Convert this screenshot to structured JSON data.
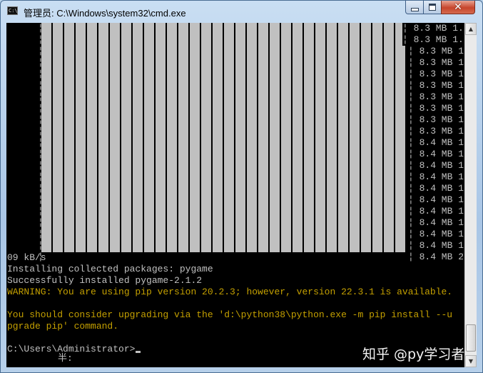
{
  "window": {
    "title": "管理员: C:\\Windows\\system32\\cmd.exe",
    "icon": "cmd-icon",
    "controls": [
      "minimize-icon",
      "maximize-icon",
      "close-icon"
    ]
  },
  "progress_rows": [
    "¦ 8.3 MB 1.",
    "¦ 8.3 MB 1.",
    "¦ 8.3 MB 1",
    "¦ 8.3 MB 1",
    "¦ 8.3 MB 1",
    "¦ 8.3 MB 1",
    "¦ 8.3 MB 1",
    "¦ 8.3 MB 1",
    "¦ 8.3 MB 1",
    "¦ 8.3 MB 1",
    "¦ 8.4 MB 1",
    "¦ 8.4 MB 1",
    "¦ 8.4 MB 1",
    "¦ 8.4 MB 1",
    "¦ 8.4 MB 1",
    "¦ 8.4 MB 1",
    "¦ 8.4 MB 1",
    "¦ 8.4 MB 1",
    "¦ 8.4 MB 1",
    "¦ 8.4 MB 1",
    "¦ 8.4 MB 2"
  ],
  "console": {
    "speed_tail": "09 kB/s",
    "installing": "Installing collected packages: pygame",
    "success": "Successfully installed pygame-2.1.2",
    "warning1": "WARNING: You are using pip version 20.2.3; however, version 22.3.1 is available.",
    "warning2a": "You should consider upgrading via the 'd:\\python38\\python.exe -m pip install --u",
    "warning2b": "pgrade pip' command.",
    "prompt": "C:\\Users\\Administrator>",
    "ime": "半:"
  },
  "watermark": "知乎 @py学习者",
  "colors": {
    "console_bg": "#000000",
    "console_fg": "#c0c0c0",
    "warning": "#c4a000",
    "titlebar": "#b9d3ec"
  }
}
